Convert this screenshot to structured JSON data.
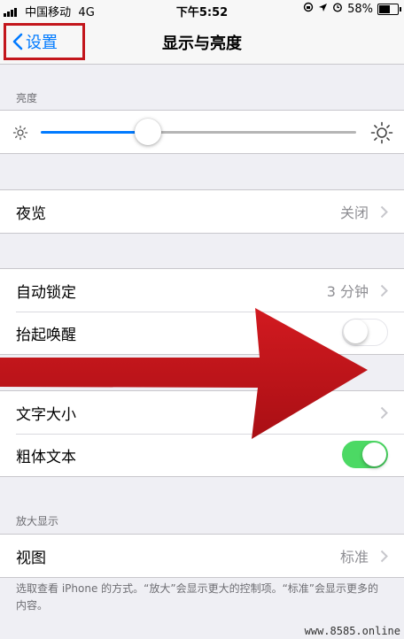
{
  "status_bar": {
    "carrier": "中国移动",
    "network": "4G",
    "time": "下午5:52",
    "battery_percent": "58%",
    "battery_level": 0.58
  },
  "nav": {
    "back_label": "设置",
    "title": "显示与亮度"
  },
  "brightness": {
    "header": "亮度",
    "level": 0.34
  },
  "night_shift": {
    "label": "夜览",
    "value": "关闭"
  },
  "auto_lock": {
    "label": "自动锁定",
    "value": "3 分钟"
  },
  "raise_to_wake": {
    "label": "抬起唤醒",
    "enabled": false
  },
  "text_size": {
    "label": "文字大小"
  },
  "bold_text": {
    "label": "粗体文本",
    "enabled": true
  },
  "zoom": {
    "header": "放大显示",
    "view_label": "视图",
    "view_value": "标准",
    "footer": "选取查看 iPhone 的方式。“放大”会显示更大的控制项。“标准”会显示更多的内容。"
  },
  "watermark": "www.8585.online",
  "colors": {
    "accent": "#007aff",
    "toggle_on": "#4cd964",
    "annotation_red": "#c3161c"
  },
  "icons": [
    "back-chevron-icon",
    "sun-small-icon",
    "sun-large-icon",
    "chevron-right-icon",
    "signal-bars-icon",
    "location-icon",
    "alarm-icon",
    "battery-icon"
  ]
}
